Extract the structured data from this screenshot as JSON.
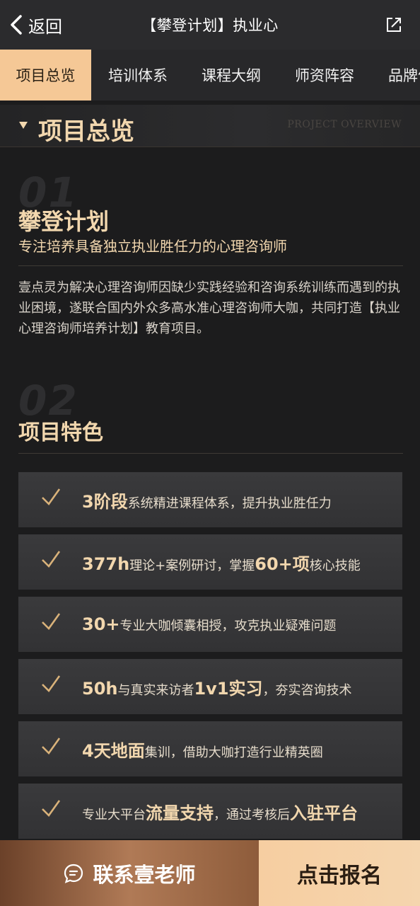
{
  "header": {
    "back_label": "返回",
    "title": "【攀登计划】执业心"
  },
  "tabs": [
    {
      "label": "项目总览",
      "active": true
    },
    {
      "label": "培训体系",
      "active": false
    },
    {
      "label": "课程大纲",
      "active": false
    },
    {
      "label": "师资阵容",
      "active": false
    },
    {
      "label": "品牌优",
      "active": false
    }
  ],
  "section": {
    "title": "项目总览",
    "title_en": "PROJECT OVERVIEW"
  },
  "overview": {
    "num": "01",
    "heading": "攀登计划",
    "subheading": "专注培养具备独立执业胜任力的心理咨询师",
    "description": "壹点灵为解决心理咨询师因缺少实践经验和咨询系统训练而遇到的执业困境，遂联合国内外众多高水准心理咨询师大咖，共同打造【执业心理咨询师培养计划】教育项目。"
  },
  "features_section": {
    "num": "02",
    "heading": "项目特色"
  },
  "features": [
    {
      "parts": [
        {
          "t": "3阶段",
          "hl": true
        },
        {
          "t": "系统精进课程体系，提升执业胜任力",
          "hl": false
        }
      ]
    },
    {
      "parts": [
        {
          "t": "377h",
          "hl": true
        },
        {
          "t": "理论+案例研讨，掌握",
          "hl": false
        },
        {
          "t": "60+项",
          "hl": true
        },
        {
          "t": "核心技能",
          "hl": false
        }
      ]
    },
    {
      "parts": [
        {
          "t": "30+",
          "hl": true
        },
        {
          "t": "专业大咖倾囊相授，攻克执业疑难问题",
          "hl": false
        }
      ]
    },
    {
      "parts": [
        {
          "t": "50h",
          "hl": true
        },
        {
          "t": "与真实来访者",
          "hl": false
        },
        {
          "t": "1v1实习",
          "hl": true
        },
        {
          "t": "，夯实咨询技术",
          "hl": false
        }
      ]
    },
    {
      "parts": [
        {
          "t": "4天地面",
          "hl": true
        },
        {
          "t": "集训，借助大咖打造行业精英圈",
          "hl": false
        }
      ]
    },
    {
      "parts": [
        {
          "t": "专业大平台",
          "hl": false
        },
        {
          "t": "流量支持",
          "hl": true
        },
        {
          "t": "，通过考核后",
          "hl": false
        },
        {
          "t": "入驻平台",
          "hl": true
        }
      ]
    }
  ],
  "bottom": {
    "contact_label": "联系壹老师",
    "signup_label": "点击报名"
  },
  "colors": {
    "accent": "#f2d7ae",
    "active_tab": "#f5c896"
  }
}
